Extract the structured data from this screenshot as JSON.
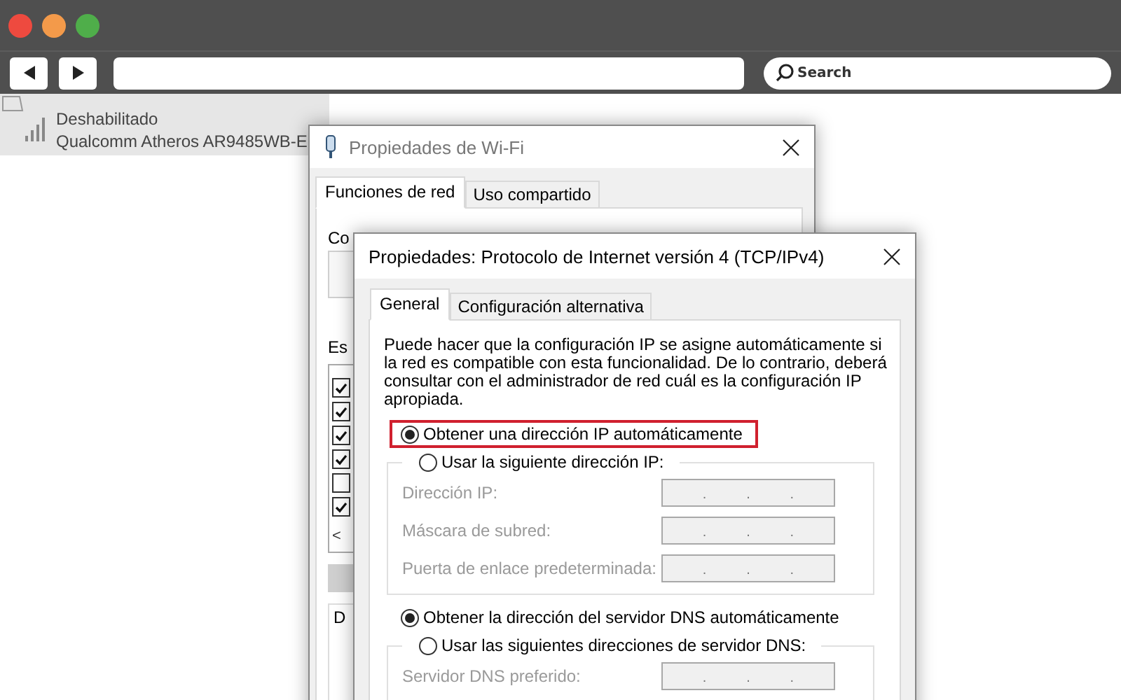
{
  "browser": {
    "search": {
      "placeholder": "Search"
    }
  },
  "adapter": {
    "status": "Deshabilitado",
    "name": "Qualcomm Atheros AR9485WB-E"
  },
  "wifi_window": {
    "title": "Propiedades de Wi-Fi",
    "tabs": [
      {
        "label": "Funciones de red",
        "selected": true
      },
      {
        "label": "Uso compartido",
        "selected": false
      }
    ],
    "connect_label": "Co",
    "components_label": "Es",
    "components": [
      {
        "checked": true
      },
      {
        "checked": true
      },
      {
        "checked": true
      },
      {
        "checked": true
      },
      {
        "checked": false
      },
      {
        "checked": true
      }
    ],
    "scroll_arrow": "<",
    "group_label": "D"
  },
  "tcp_dialog": {
    "title": "Propiedades: Protocolo de Internet versión 4 (TCP/IPv4)",
    "tabs": [
      {
        "label": "General",
        "selected": true
      },
      {
        "label": "Configuración alternativa",
        "selected": false
      }
    ],
    "description": "Puede hacer que la configuración IP se asigne automáticamente si la red es compatible con esta funcionalidad. De lo contrario, deberá consultar con el administrador de red cuál es la configuración IP apropiada.",
    "ip_options": [
      {
        "label": "Obtener una dirección IP automáticamente",
        "selected": true,
        "highlighted": true
      },
      {
        "label": "Usar la siguiente dirección IP:",
        "selected": false,
        "highlighted": false
      }
    ],
    "ip_fields": [
      {
        "label": "Dirección IP:",
        "disabled": true
      },
      {
        "label": "Máscara de subred:",
        "disabled": true
      },
      {
        "label": "Puerta de enlace predeterminada:",
        "disabled": true
      }
    ],
    "dns_options": [
      {
        "label": "Obtener la dirección del servidor DNS automáticamente",
        "selected": true,
        "highlighted": false
      },
      {
        "label": "Usar las siguientes direcciones de servidor DNS:",
        "selected": false,
        "highlighted": false
      }
    ],
    "dns_fields": [
      {
        "label": "Servidor DNS preferido:",
        "disabled": true
      }
    ],
    "separator": "."
  }
}
